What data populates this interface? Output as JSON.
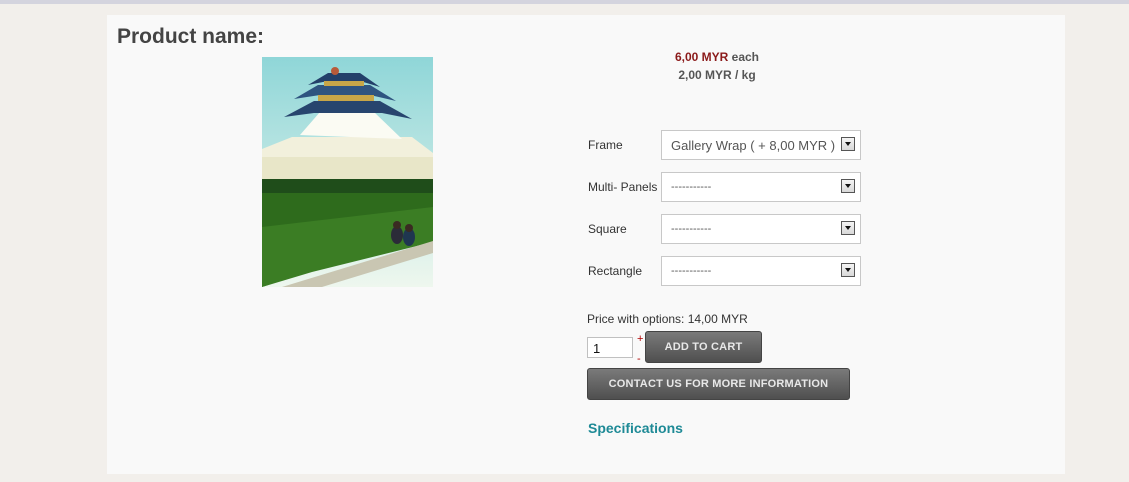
{
  "product": {
    "title": "Product name:"
  },
  "prices": {
    "main_price": "6,00 MYR",
    "main_suffix": " each",
    "unit_price": "2,00 MYR / kg"
  },
  "options": [
    {
      "label": "Frame",
      "value": "Gallery Wrap ( + 8,00 MYR )"
    },
    {
      "label": "Multi- Panels",
      "value": "-----------"
    },
    {
      "label": "Square",
      "value": "-----------"
    },
    {
      "label": "Rectangle",
      "value": "-----------"
    }
  ],
  "price_with_options": "Price with options: 14,00 MYR",
  "quantity": {
    "value": "1",
    "plus": "+",
    "minus": "-"
  },
  "buttons": {
    "add_to_cart": "ADD TO CART",
    "contact": "CONTACT US FOR MORE INFORMATION"
  },
  "specifications_link": "Specifications",
  "colors": {
    "price_red": "#8b1a1a",
    "link_teal": "#1e8a96",
    "button_gray": "#5a5a5a"
  }
}
